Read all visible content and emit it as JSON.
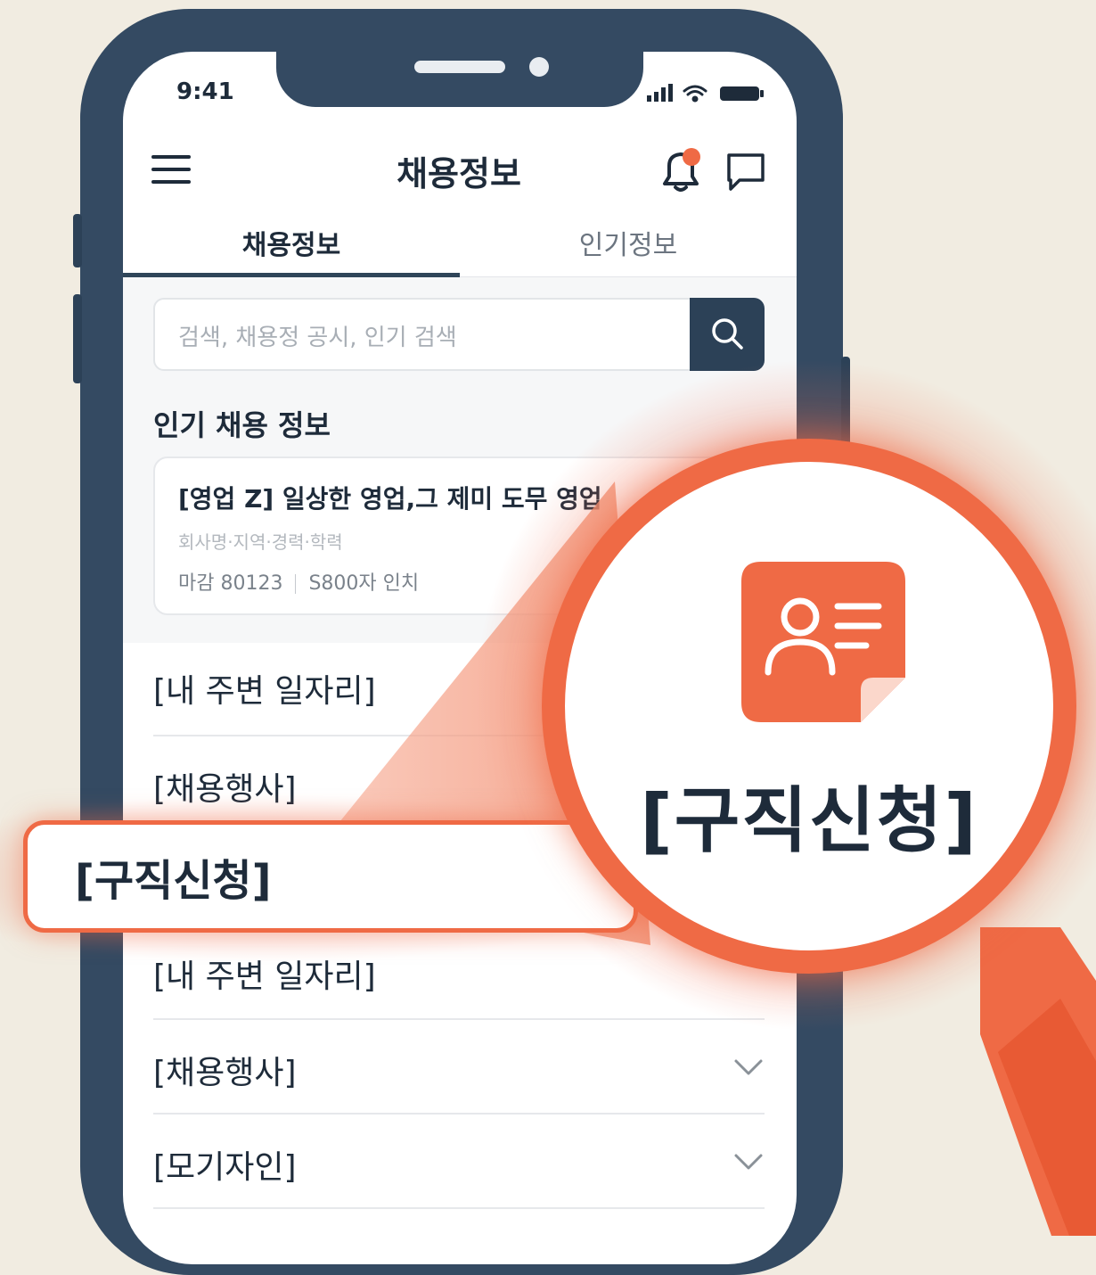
{
  "status_bar": {
    "time": "9:41"
  },
  "header": {
    "title": "채용정보",
    "menu_icon": "hamburger-icon",
    "notification_icon": "bell-icon",
    "chat_icon": "chat-bubble-icon"
  },
  "tabs": [
    {
      "label": "채용정보",
      "active": true
    },
    {
      "label": "인기정보",
      "active": false
    }
  ],
  "search": {
    "placeholder": "검색, 채용정 공시, 인기 검색",
    "button_icon": "search-icon"
  },
  "popular_section": {
    "title": "인기 채용 정보",
    "job_card": {
      "title": "[영업 Z] 일상한 영업,그 제미 도무 영업",
      "subtitle": "회사명·지역·경력·학력",
      "meta_left": "마감 80123",
      "meta_right": "S800자 인치"
    }
  },
  "menu_list": [
    {
      "label": "[내 주변 일자리]"
    },
    {
      "label": "[채용행사]"
    },
    {
      "label": "[구직신청]",
      "highlighted": true
    },
    {
      "label": "[내 주변 일자리]"
    },
    {
      "label": "[채용행사]",
      "has_chevron": true
    },
    {
      "label": "[모기자인]",
      "has_chevron": true
    }
  ],
  "magnifier": {
    "label": "[구직신청]",
    "icon": "job-application-icon"
  },
  "colors": {
    "accent": "#ef6a45",
    "navy": "#2c4157",
    "background": "#f1ece1"
  }
}
